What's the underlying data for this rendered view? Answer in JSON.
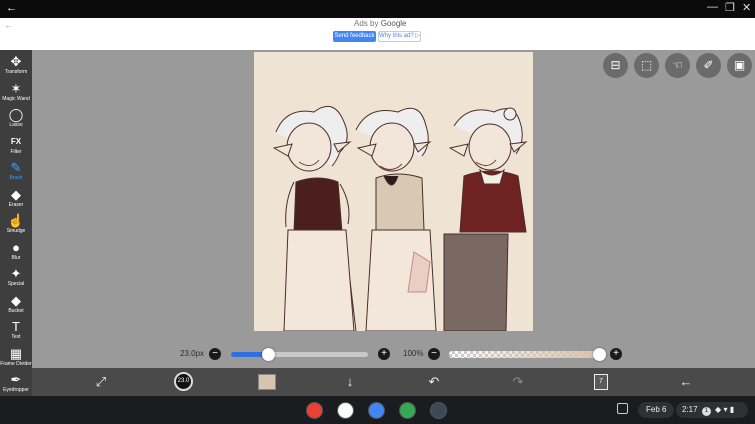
{
  "window": {
    "back_glyph": "←",
    "minimize_glyph": "—",
    "maximize_glyph": "❐",
    "close_glyph": "✕"
  },
  "ad": {
    "back_glyph": "←",
    "ads_by": "Ads by",
    "ads_brand": "Google",
    "send_feedback": "Send feedback",
    "why_this_ad": "Why this ad? ▷"
  },
  "toolbar": {
    "items": [
      {
        "id": "transform",
        "label": "Transform",
        "icon": "move-arrows-icon",
        "glyph": "✥"
      },
      {
        "id": "magic-wand",
        "label": "Magic Wand",
        "icon": "magic-wand-icon",
        "glyph": "✶"
      },
      {
        "id": "lasso",
        "label": "Lasso",
        "icon": "lasso-icon",
        "glyph": "◯"
      },
      {
        "id": "filter",
        "label": "Filter",
        "icon": "fx-icon",
        "glyph": "FX"
      },
      {
        "id": "brush",
        "label": "Brush",
        "icon": "brush-icon",
        "glyph": "✎",
        "active": true
      },
      {
        "id": "eraser",
        "label": "Eraser",
        "icon": "eraser-icon",
        "glyph": "◆"
      },
      {
        "id": "smudge",
        "label": "Smudge",
        "icon": "smudge-icon",
        "glyph": "☝"
      },
      {
        "id": "blur",
        "label": "Blur",
        "icon": "blur-drop-icon",
        "glyph": "●"
      },
      {
        "id": "special",
        "label": "Special",
        "icon": "special-wand-icon",
        "glyph": "✦"
      },
      {
        "id": "bucket",
        "label": "Bucket",
        "icon": "bucket-icon",
        "glyph": "◆"
      },
      {
        "id": "text",
        "label": "Text",
        "icon": "text-icon",
        "glyph": "T"
      },
      {
        "id": "frame-divider",
        "label": "Frame Divider",
        "icon": "frame-divider-icon",
        "glyph": "▦"
      },
      {
        "id": "eyedropper",
        "label": "Eyedropper",
        "icon": "eyedropper-icon",
        "glyph": "✒"
      }
    ]
  },
  "float_tools": [
    {
      "id": "toggle",
      "icon": "toggle-panel-icon",
      "glyph": "⊟"
    },
    {
      "id": "select",
      "icon": "selection-icon",
      "glyph": "⬚"
    },
    {
      "id": "hand",
      "icon": "hand-tool-icon",
      "glyph": "☜"
    },
    {
      "id": "ruler",
      "icon": "ruler-icon",
      "glyph": "✐"
    },
    {
      "id": "reference",
      "icon": "image-reference-icon",
      "glyph": "▣"
    }
  ],
  "brush": {
    "size_label": "23.0px",
    "size_fraction": 0.27,
    "opacity_label": "100%",
    "opacity_fraction": 1.0,
    "minus_glyph": "−",
    "plus_glyph": "+"
  },
  "bottom_bar": {
    "color_value": "23.0",
    "secondary_color": "#d8c3ad",
    "primary_color": "#111111",
    "layer_count": "7",
    "glyphs": {
      "select_tools": "⤢",
      "download": "↓",
      "undo": "↶",
      "redo": "↷",
      "back": "←"
    }
  },
  "shelf": {
    "date": "Feb 6",
    "time": "2:17",
    "notification_count": "1",
    "apps": [
      {
        "name": "Chrome",
        "color": "#e94235"
      },
      {
        "name": "Gmail",
        "color": "#ffffff"
      },
      {
        "name": "Docs",
        "color": "#4285f4"
      },
      {
        "name": "Play Store",
        "color": "#34a853"
      },
      {
        "name": "ibisPaint",
        "color": "#3c4a57"
      }
    ]
  },
  "colors": {
    "canvas_bg": "#efe3d4",
    "accent": "#2f6fe0",
    "active_tool": "#4a9bff"
  }
}
